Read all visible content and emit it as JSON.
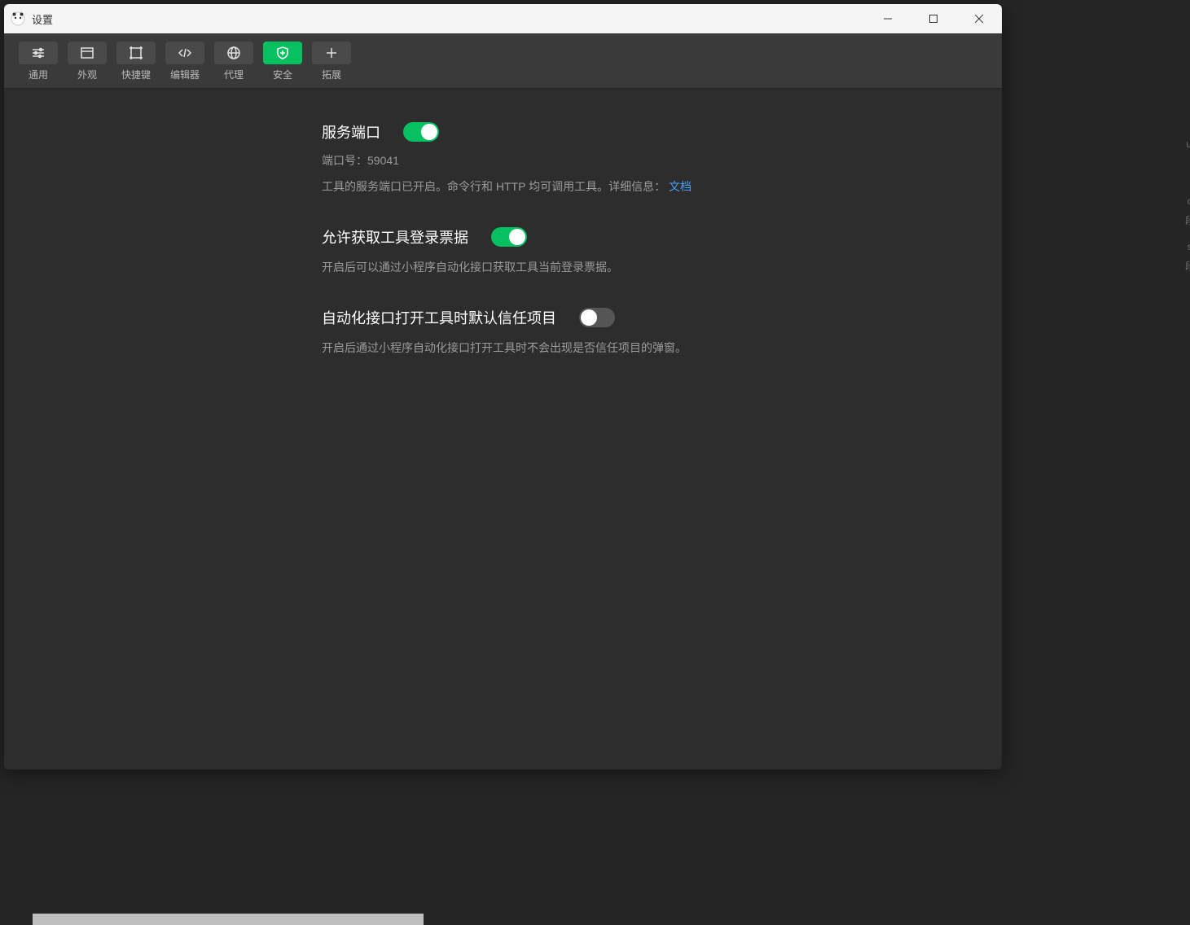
{
  "window": {
    "title": "设置"
  },
  "tabs": [
    {
      "id": "general",
      "label": "通用",
      "icon": "sliders"
    },
    {
      "id": "appearance",
      "label": "外观",
      "icon": "layout"
    },
    {
      "id": "shortcut",
      "label": "快捷键",
      "icon": "frame"
    },
    {
      "id": "editor",
      "label": "编辑器",
      "icon": "code"
    },
    {
      "id": "proxy",
      "label": "代理",
      "icon": "globe"
    },
    {
      "id": "security",
      "label": "安全",
      "icon": "shield",
      "active": true
    },
    {
      "id": "extension",
      "label": "拓展",
      "icon": "plus"
    }
  ],
  "security": {
    "port": {
      "heading": "服务端口",
      "toggle_on": true,
      "port_label": "端口号：",
      "port_value": "59041",
      "desc_prefix": "工具的服务端口已开启。命令行和 HTTP 均可调用工具。详细信息：",
      "doc_link": "文档"
    },
    "ticket": {
      "heading": "允许获取工具登录票据",
      "toggle_on": true,
      "desc": "开启后可以通过小程序自动化接口获取工具当前登录票据。"
    },
    "trust": {
      "heading": "自动化接口打开工具时默认信任项目",
      "toggle_on": false,
      "desc": "开启后通过小程序自动化接口打开工具时不会出现是否信任项目的弹窗。"
    }
  }
}
